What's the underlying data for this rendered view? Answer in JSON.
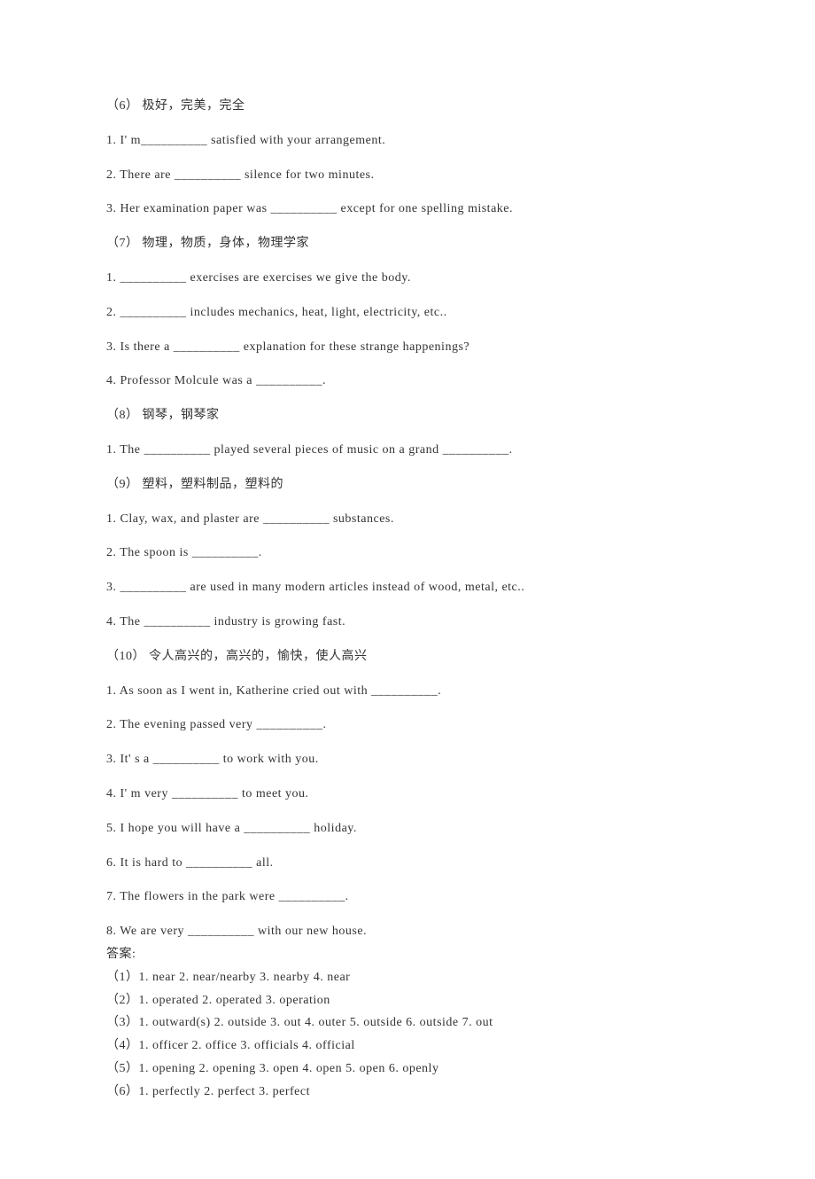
{
  "lines": [
    "（6） 极好，完美，完全",
    "1. I' m__________ satisfied with your arrangement.",
    "2. There are __________ silence for two minutes.",
    "3. Her examination paper was __________ except for one spelling mistake.",
    "（7） 物理，物质，身体，物理学家",
    "1. __________ exercises are exercises we give the body.",
    "2. __________ includes mechanics, heat, light, electricity, etc..",
    "3. Is there a __________ explanation for these strange happenings?",
    "4. Professor Molcule was a __________.",
    "（8） 钢琴，钢琴家",
    "1. The __________ played several pieces of music on a grand __________.",
    "（9） 塑料，塑料制品，塑料的",
    "1. Clay, wax, and plaster are __________ substances.",
    "2. The spoon is __________.",
    "3. __________ are used in many modern articles instead of wood, metal, etc..",
    "4. The __________ industry is growing fast.",
    "（10） 令人高兴的，高兴的，愉快，使人高兴",
    "1. As soon as I went in, Katherine cried out with __________.",
    "2. The evening passed very __________.",
    "3. It' s a __________ to work with you.",
    "4. I' m very __________ to meet you.",
    "5. I hope you will have a __________ holiday.",
    "6. It is hard to __________ all.",
    "7. The flowers in the park were __________.",
    "8. We are very __________ with our new house."
  ],
  "answers": [
    "答案:",
    "（1）1. near 2. near/nearby 3. nearby 4. near",
    "（2）1. operated 2. operated 3. operation",
    "（3）1. outward(s) 2. outside 3. out 4. outer 5. outside 6. outside 7. out",
    "（4）1. officer 2. office 3. officials 4. official",
    "（5）1. opening 2. opening 3. open 4. open 5. open 6. openly",
    "（6）1. perfectly 2. perfect 3. perfect"
  ]
}
